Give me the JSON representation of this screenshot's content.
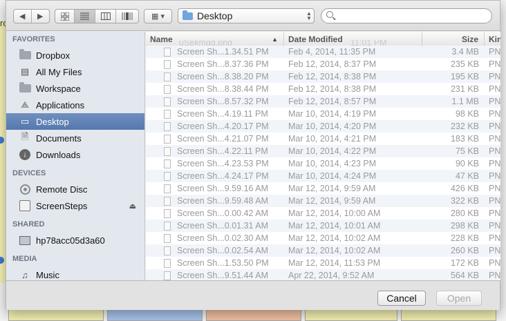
{
  "background_app": {
    "partial_text": "ro"
  },
  "toolbar": {
    "back_icon": "chevron-left",
    "forward_icon": "chevron-right",
    "view_modes": [
      "icon-view",
      "list-view",
      "column-view",
      "coverflow-view"
    ],
    "arrange_icon": "arrange-grid",
    "location": "Desktop",
    "search_placeholder": ""
  },
  "sidebar": {
    "sections": [
      {
        "title": "FAVORITES",
        "items": [
          {
            "label": "Dropbox",
            "icon": "folder-icon"
          },
          {
            "label": "All My Files",
            "icon": "all-files-icon"
          },
          {
            "label": "Workspace",
            "icon": "folder-icon"
          },
          {
            "label": "Applications",
            "icon": "applications-icon"
          },
          {
            "label": "Desktop",
            "icon": "desktop-icon",
            "selected": true
          },
          {
            "label": "Documents",
            "icon": "documents-icon"
          },
          {
            "label": "Downloads",
            "icon": "downloads-icon"
          }
        ]
      },
      {
        "title": "DEVICES",
        "items": [
          {
            "label": "Remote Disc",
            "icon": "disc-icon"
          },
          {
            "label": "ScreenSteps",
            "icon": "drive-icon",
            "eject": true
          }
        ]
      },
      {
        "title": "SHARED",
        "items": [
          {
            "label": "hp78acc05d3a60",
            "icon": "monitor-icon"
          }
        ]
      },
      {
        "title": "MEDIA",
        "items": [
          {
            "label": "Music",
            "icon": "music-icon"
          }
        ]
      }
    ]
  },
  "filelist": {
    "columns": {
      "name": "Name",
      "date": "Date Modified",
      "size": "Size",
      "kind": "Kind"
    },
    "ghost_row": {
      "name": "uSekmgg.png",
      "time": "11:01 PM"
    },
    "rows": [
      {
        "name": "Screen Sh...1.34.51 PM",
        "date": "Feb 4, 2014, 11:35 PM",
        "size": "3.4 MB",
        "kind": "PNG"
      },
      {
        "name": "Screen Sh...8.37.36 PM",
        "date": "Feb 12, 2014, 8:37 PM",
        "size": "235 KB",
        "kind": "PNG"
      },
      {
        "name": "Screen Sh...8.38.20 PM",
        "date": "Feb 12, 2014, 8:38 PM",
        "size": "195 KB",
        "kind": "PNG"
      },
      {
        "name": "Screen Sh...8.38.44 PM",
        "date": "Feb 12, 2014, 8:38 PM",
        "size": "231 KB",
        "kind": "PNG"
      },
      {
        "name": "Screen Sh...8.57.32 PM",
        "date": "Feb 12, 2014, 8:57 PM",
        "size": "1.1 MB",
        "kind": "PNG"
      },
      {
        "name": "Screen Sh...4.19.11 PM",
        "date": "Mar 10, 2014, 4:19 PM",
        "size": "98 KB",
        "kind": "PNG"
      },
      {
        "name": "Screen Sh...4.20.17 PM",
        "date": "Mar 10, 2014, 4:20 PM",
        "size": "232 KB",
        "kind": "PNG"
      },
      {
        "name": "Screen Sh...4.21.07 PM",
        "date": "Mar 10, 2014, 4:21 PM",
        "size": "183 KB",
        "kind": "PNG"
      },
      {
        "name": "Screen Sh...4.22.11 PM",
        "date": "Mar 10, 2014, 4:22 PM",
        "size": "75 KB",
        "kind": "PNG"
      },
      {
        "name": "Screen Sh...4.23.53 PM",
        "date": "Mar 10, 2014, 4:23 PM",
        "size": "90 KB",
        "kind": "PNG"
      },
      {
        "name": "Screen Sh...4.24.17 PM",
        "date": "Mar 10, 2014, 4:24 PM",
        "size": "47 KB",
        "kind": "PNG"
      },
      {
        "name": "Screen Sh...9.59.16 AM",
        "date": "Mar 12, 2014, 9:59 AM",
        "size": "426 KB",
        "kind": "PNG"
      },
      {
        "name": "Screen Sh...9.59.48 AM",
        "date": "Mar 12, 2014, 9:59 AM",
        "size": "322 KB",
        "kind": "PNG"
      },
      {
        "name": "Screen Sh...0.00.42 AM",
        "date": "Mar 12, 2014, 10:00 AM",
        "size": "280 KB",
        "kind": "PNG"
      },
      {
        "name": "Screen Sh...0.01.31 AM",
        "date": "Mar 12, 2014, 10:01 AM",
        "size": "298 KB",
        "kind": "PNG"
      },
      {
        "name": "Screen Sh...0.02.30 AM",
        "date": "Mar 12, 2014, 10:02 AM",
        "size": "228 KB",
        "kind": "PNG"
      },
      {
        "name": "Screen Sh...0.02.54 AM",
        "date": "Mar 12, 2014, 10:02 AM",
        "size": "260 KB",
        "kind": "PNG"
      },
      {
        "name": "Screen Sh...1.53.50 PM",
        "date": "Mar 12, 2014, 11:53 PM",
        "size": "172 KB",
        "kind": "PNG"
      },
      {
        "name": "Screen Sh...9.51.44 AM",
        "date": "Apr 22, 2014, 9:52 AM",
        "size": "564 KB",
        "kind": "PNG"
      }
    ]
  },
  "buttons": {
    "cancel": "Cancel",
    "open": "Open"
  }
}
